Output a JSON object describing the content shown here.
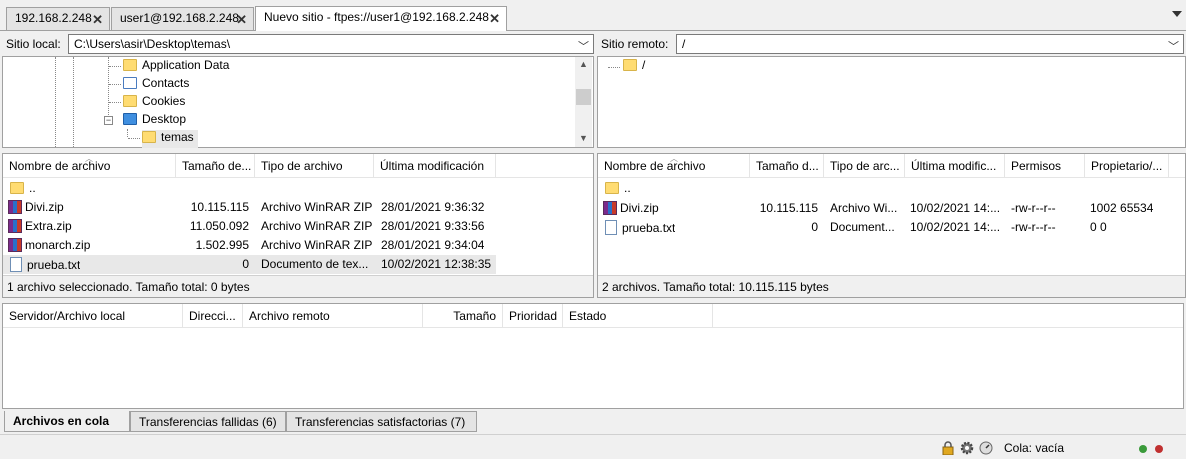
{
  "tabs": [
    {
      "label": "192.168.2.248"
    },
    {
      "label": "user1@192.168.2.248"
    },
    {
      "label": "Nuevo sitio - ftpes://user1@192.168.2.248"
    }
  ],
  "local": {
    "site_label": "Sitio local:",
    "path": "C:\\Users\\asir\\Desktop\\temas\\",
    "tree": [
      {
        "label": "Application Data",
        "icon": "folder-icon"
      },
      {
        "label": "Contacts",
        "icon": "contacts-icon"
      },
      {
        "label": "Cookies",
        "icon": "folder-icon"
      },
      {
        "label": "Desktop",
        "icon": "desktop-icon"
      },
      {
        "label": "temas",
        "icon": "folder-icon"
      }
    ],
    "columns": [
      "Nombre de archivo",
      "Tamaño de...",
      "Tipo de archivo",
      "Última modificación"
    ],
    "files": [
      {
        "name": "..",
        "size": "",
        "type": "",
        "modified": ""
      },
      {
        "name": "Divi.zip",
        "size": "10.115.115",
        "type": "Archivo WinRAR ZIP",
        "modified": "28/01/2021 9:36:32"
      },
      {
        "name": "Extra.zip",
        "size": "11.050.092",
        "type": "Archivo WinRAR ZIP",
        "modified": "28/01/2021 9:33:56"
      },
      {
        "name": "monarch.zip",
        "size": "1.502.995",
        "type": "Archivo WinRAR ZIP",
        "modified": "28/01/2021 9:34:04"
      },
      {
        "name": "prueba.txt",
        "size": "0",
        "type": "Documento de tex...",
        "modified": "10/02/2021 12:38:35"
      }
    ],
    "status": "1 archivo seleccionado. Tamaño total: 0 bytes"
  },
  "remote": {
    "site_label": "Sitio remoto:",
    "path": "/",
    "tree": [
      {
        "label": "/"
      }
    ],
    "columns": [
      "Nombre de archivo",
      "Tamaño d...",
      "Tipo de arc...",
      "Última modific...",
      "Permisos",
      "Propietario/..."
    ],
    "files": [
      {
        "name": "..",
        "size": "",
        "type": "",
        "modified": "",
        "perms": "",
        "owner": ""
      },
      {
        "name": "Divi.zip",
        "size": "10.115.115",
        "type": "Archivo Wi...",
        "modified": "10/02/2021 14:...",
        "perms": "-rw-r--r--",
        "owner": "1002 65534"
      },
      {
        "name": "prueba.txt",
        "size": "0",
        "type": "Document...",
        "modified": "10/02/2021 14:...",
        "perms": "-rw-r--r--",
        "owner": "0 0"
      }
    ],
    "status": "2 archivos. Tamaño total: 10.115.115 bytes"
  },
  "queue": {
    "columns": [
      "Servidor/Archivo local",
      "Direcci...",
      "Archivo remoto",
      "Tamaño",
      "Prioridad",
      "Estado"
    ],
    "tabs": [
      "Archivos en cola",
      "Transferencias fallidas (6)",
      "Transferencias satisfactorias (7)"
    ]
  },
  "statusbar": {
    "queue_label": "Cola: vacía"
  }
}
